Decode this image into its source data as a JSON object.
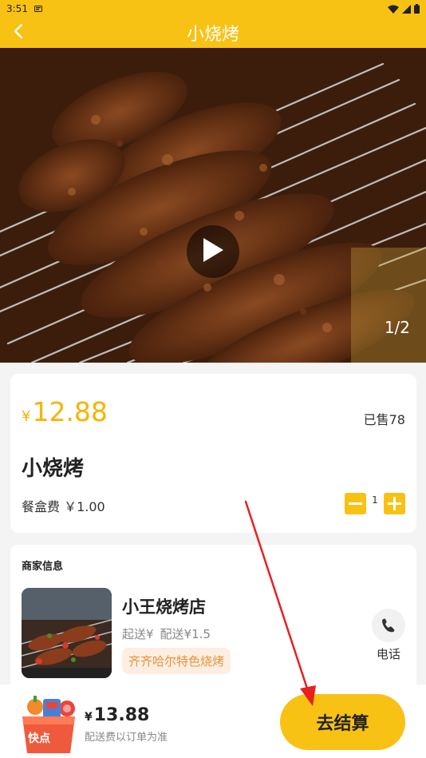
{
  "status_bar": {
    "time": "3:51",
    "icons": [
      "notification-icon",
      "wifi-icon",
      "signal-icon",
      "battery-icon"
    ]
  },
  "header": {
    "title": "小烧烤",
    "back_icon": "chevron-left-icon"
  },
  "hero": {
    "pager": "1/2",
    "play_icon": "play-icon"
  },
  "product": {
    "currency": "¥",
    "price": "12.88",
    "sold": "已售78",
    "name": "小烧烤",
    "box_fee": "餐盒费 ￥1.00",
    "quantity": "1"
  },
  "shop": {
    "section_title": "商家信息",
    "name": "小王烧烤店",
    "min_order": "起送¥",
    "delivery_fee": "配送¥1.5",
    "tag": "齐齐哈尔特色烧烤",
    "call_label": "电话",
    "call_icon": "phone-icon"
  },
  "bottom_bar": {
    "currency": "¥",
    "total": "13.88",
    "note": "配送费以订单为准",
    "checkout_label": "去结算",
    "basket_text": "快点"
  },
  "colors": {
    "accent": "#f7c214",
    "price": "#f7b400",
    "tag_bg": "#fdeee1",
    "tag_text": "#e8913a",
    "annotation": "#e8201e"
  }
}
